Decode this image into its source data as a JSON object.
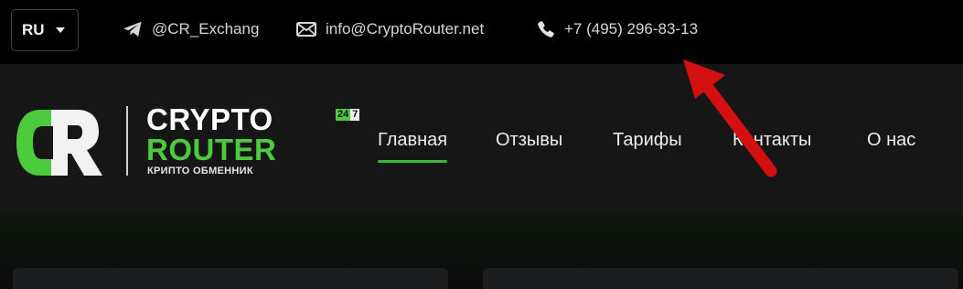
{
  "topbar": {
    "language": "RU",
    "telegram": "@CR_Exchang",
    "email": "info@CryptoRouter.net",
    "phone": "+7 (495) 296-83-13"
  },
  "brand": {
    "line1": "CRYPTO",
    "line2": "ROUTER",
    "subtitle": "КРИПТО ОБМЕННИК",
    "badge_24": "24",
    "badge_7": "7"
  },
  "nav": {
    "items": [
      {
        "label": "Главная",
        "active": true
      },
      {
        "label": "Отзывы",
        "active": false
      },
      {
        "label": "Тарифы",
        "active": false
      },
      {
        "label": "Контакты",
        "active": false
      },
      {
        "label": "О нас",
        "active": false
      }
    ]
  },
  "colors": {
    "accent_green": "#4ccb3c",
    "topbar_bg": "#000000",
    "header_bg": "#161616",
    "annotation_arrow": "#d40f0f"
  },
  "icons": {
    "telegram": "telegram-icon",
    "email": "email-icon",
    "phone": "phone-icon",
    "language_caret": "caret-down-icon",
    "logo": "cr-logo-icon"
  }
}
